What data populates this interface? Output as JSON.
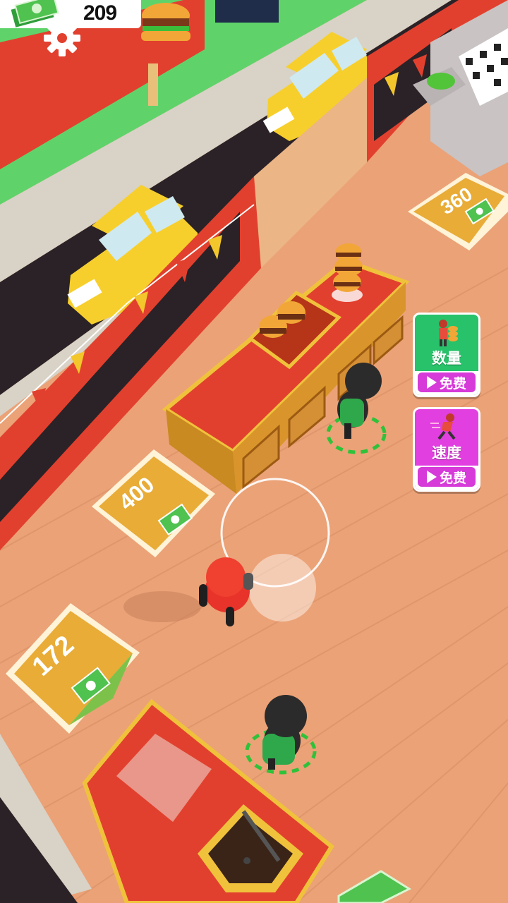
{
  "hud": {
    "money": "209",
    "money_icon": "cash-stack-icon",
    "settings_icon": "gear-icon"
  },
  "boosts": {
    "quantity": {
      "label": "数量",
      "free_label": "免费",
      "icon": "play-icon"
    },
    "speed": {
      "label": "速度",
      "free_label": "免费",
      "icon": "play-icon"
    }
  },
  "pads": {
    "pad_top_right": {
      "cost": "360",
      "icon": "cash-icon"
    },
    "pad_middle": {
      "cost": "400",
      "icon": "cash-icon"
    },
    "pad_bottom_left": {
      "cost": "172",
      "icon": "cash-icon",
      "progress": 0.35
    }
  },
  "colors": {
    "floor": "#eba277",
    "road": "#2a2226",
    "grass": "#5fd36a",
    "wall_red": "#e2402e",
    "pad_yellow": "#e8ac37",
    "counter_red": "#e0481f",
    "car_yellow": "#f7cf2c",
    "boost_green": "#27c26a",
    "boost_magenta": "#e23fe0"
  }
}
